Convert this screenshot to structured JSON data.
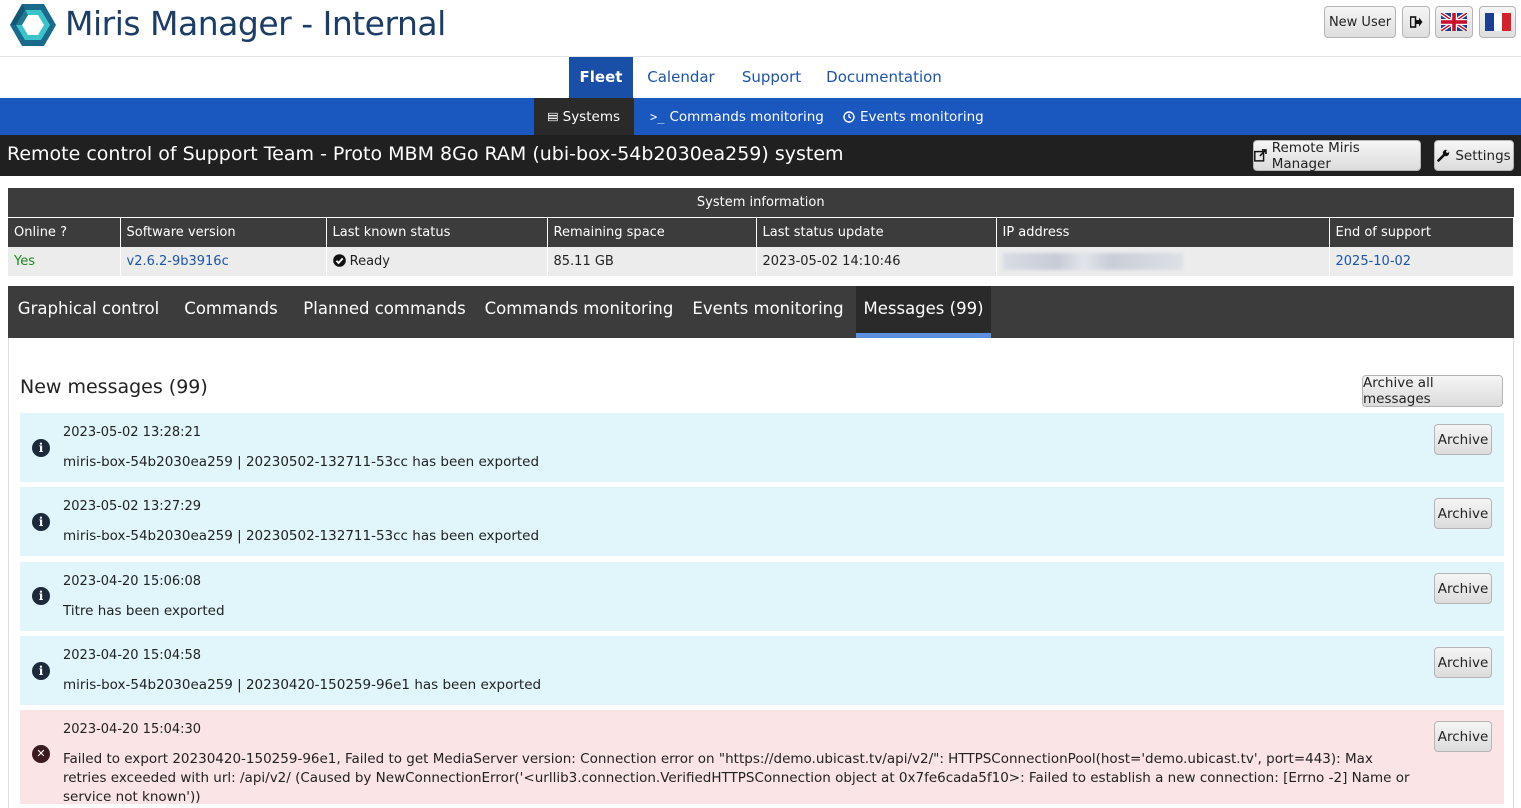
{
  "header": {
    "app_title": "Miris Manager - Internal",
    "new_user_label": "New User",
    "logout_icon": "sign-out-icon",
    "lang_en_icon": "uk-flag-icon",
    "lang_fr_icon": "france-flag-icon"
  },
  "main_nav": {
    "items": [
      {
        "label": "Fleet",
        "active": true
      },
      {
        "label": "Calendar"
      },
      {
        "label": "Support"
      },
      {
        "label": "Documentation"
      }
    ]
  },
  "sub_nav": {
    "items": [
      {
        "label": "Systems",
        "icon": "server-icon",
        "active": true
      },
      {
        "label": "Commands monitoring",
        "icon": "terminal-icon"
      },
      {
        "label": "Events monitoring",
        "icon": "clock-icon"
      }
    ]
  },
  "title_bar": {
    "title": "Remote control of Support Team - Proto MBM 8Go RAM (ubi-box-54b2030ea259) system",
    "remote_button": "Remote Miris Manager",
    "settings_button": "Settings"
  },
  "system_info": {
    "caption": "System information",
    "columns": [
      "Online ?",
      "Software version",
      "Last known status",
      "Remaining space",
      "Last status update",
      "IP address",
      "End of support"
    ],
    "row": {
      "online": "Yes",
      "software_version": "v2.6.2-9b3916c",
      "status": "Ready",
      "remaining_space": "85.11 GB",
      "last_update": "2023-05-02 14:10:46",
      "end_of_support": "2025-10-02"
    }
  },
  "tabs": [
    {
      "label": "Graphical control"
    },
    {
      "label": "Commands"
    },
    {
      "label": "Planned commands"
    },
    {
      "label": "Commands monitoring"
    },
    {
      "label": "Events monitoring"
    },
    {
      "label": "Messages (99)",
      "active": true
    }
  ],
  "messages_panel": {
    "title": "New messages (99)",
    "archive_all_label": "Archive all messages",
    "archive_label": "Archive",
    "messages": [
      {
        "type": "info",
        "date": "2023-05-02 13:28:21",
        "text": "miris-box-54b2030ea259 | 20230502-132711-53cc has been exported"
      },
      {
        "type": "info",
        "date": "2023-05-02 13:27:29",
        "text": "miris-box-54b2030ea259 | 20230502-132711-53cc has been exported"
      },
      {
        "type": "info",
        "date": "2023-04-20 15:06:08",
        "text": "Titre has been exported"
      },
      {
        "type": "info",
        "date": "2023-04-20 15:04:58",
        "text": "miris-box-54b2030ea259 | 20230420-150259-96e1 has been exported"
      },
      {
        "type": "error",
        "date": "2023-04-20 15:04:30",
        "text": "Failed to export 20230420-150259-96e1, Failed to get MediaServer version: Connection error on \"https://demo.ubicast.tv/api/v2/\": HTTPSConnectionPool(host='demo.ubicast.tv', port=443): Max retries exceeded with url: /api/v2/ (Caused by NewConnectionError('<urllib3.connection.VerifiedHTTPSConnection object at 0x7fe6cada5f10>: Failed to establish a new connection: [Errno -2] Name or service not known'))"
      }
    ]
  }
}
